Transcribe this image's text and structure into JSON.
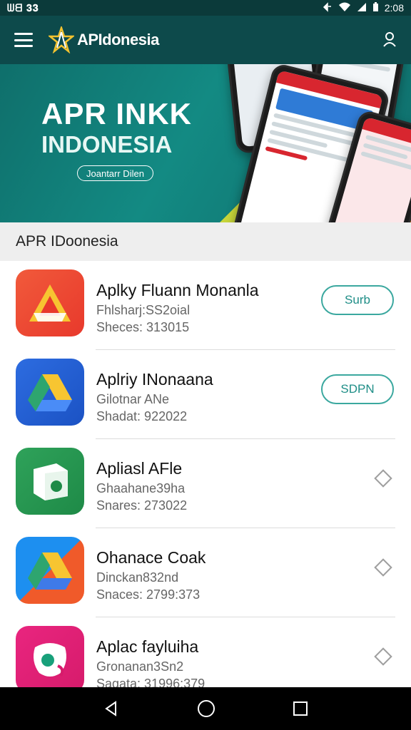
{
  "status_bar": {
    "left_text": "ᗯᗺ 𝟑𝟑",
    "time": "2:08",
    "icons": [
      "signal-icon",
      "wifi-icon",
      "cell-icon",
      "battery-icon"
    ]
  },
  "app_bar": {
    "logo_text": "APIdonesia",
    "menu_icon": "menu-icon",
    "user_icon": "user-icon"
  },
  "hero": {
    "title_line1": "APR INKK",
    "title_line2": "INDONESIA",
    "button_label": "Joantarr Dilen"
  },
  "section_title": "APR IDoonesia",
  "apps": [
    {
      "name": "Aplky Fluann Monanla",
      "subtitle": "Fhlsharj:SS2oial",
      "meta": "Sheces: 313015",
      "action": "button",
      "action_label": "Surb",
      "icon": "triangle-red-icon"
    },
    {
      "name": "Aplriy INonaana",
      "subtitle": "Gilotnar ANe",
      "meta": "Shadat: 922022",
      "action": "button",
      "action_label": "SDPN",
      "icon": "drive-blue-icon"
    },
    {
      "name": "Apliasl AFle",
      "subtitle": "Ghaahane39ha",
      "meta": "Snares: 273022",
      "action": "diamond",
      "action_label": "",
      "icon": "green-box-icon"
    },
    {
      "name": "Ohanace Coak",
      "subtitle": "Dinckan832nd",
      "meta": "Snaces: 2799:373",
      "action": "diamond",
      "action_label": "",
      "icon": "drive-multi-icon"
    },
    {
      "name": "Aplac fayluiha",
      "subtitle": "Gronanan3Sn2",
      "meta": "Sagata: 31996:379",
      "action": "diamond",
      "action_label": "",
      "icon": "pink-cup-icon"
    }
  ],
  "nav_bar": {
    "buttons": [
      "back-icon",
      "home-icon",
      "recents-icon"
    ]
  },
  "colors": {
    "app_bar": "#0d4a4b",
    "hero": "#138a83",
    "accent": "#3ba89f"
  }
}
